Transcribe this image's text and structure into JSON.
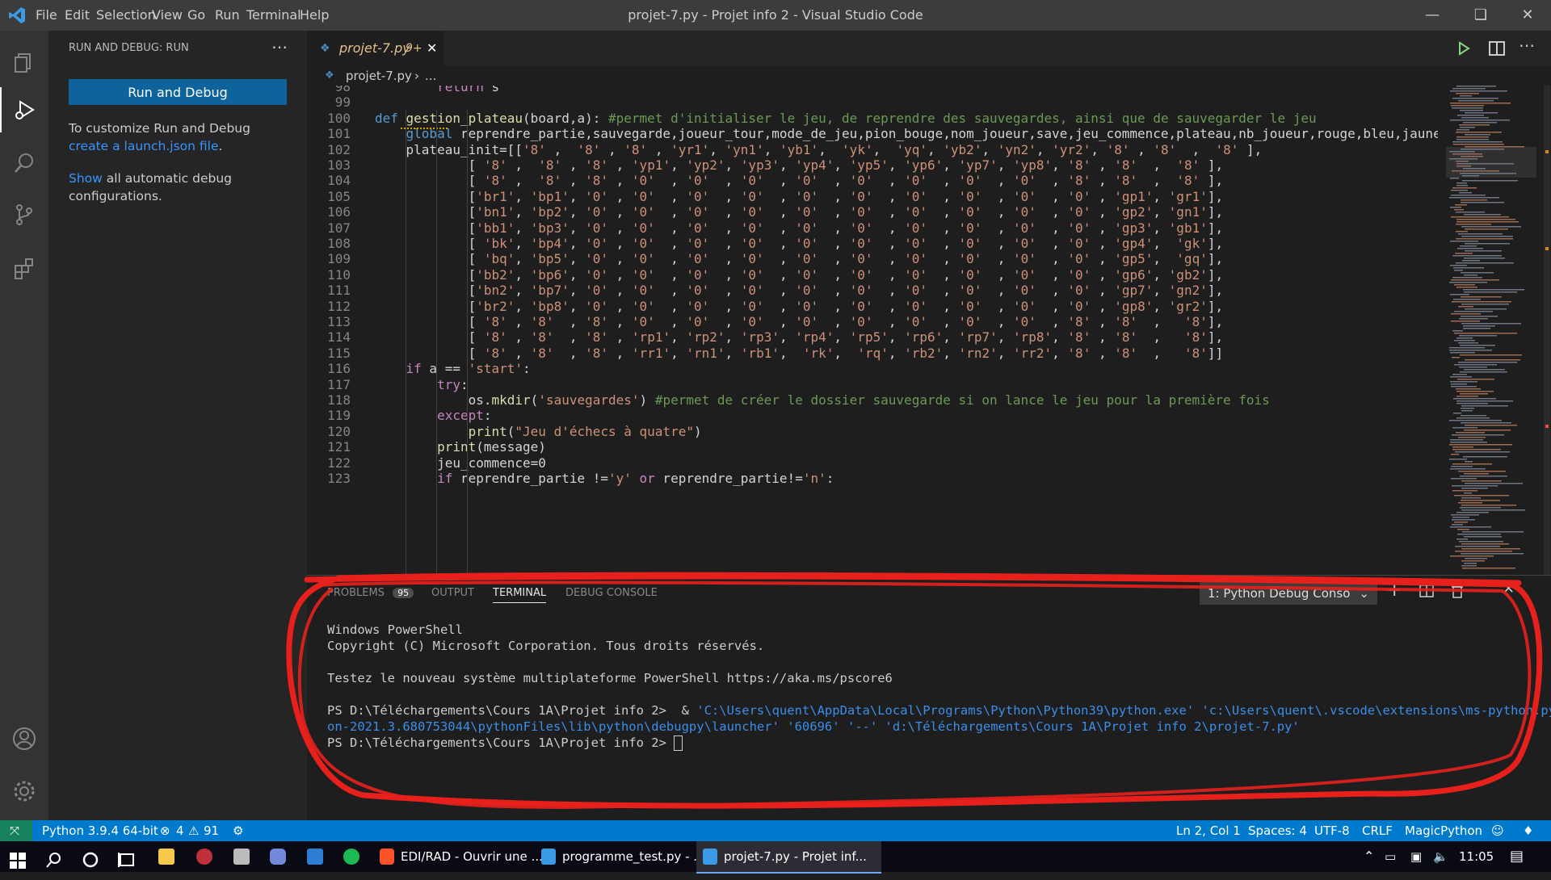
{
  "window": {
    "title": "projet-7.py - Projet info 2 - Visual Studio Code",
    "menu": [
      "File",
      "Edit",
      "Selection",
      "View",
      "Go",
      "Run",
      "Terminal",
      "Help"
    ]
  },
  "sidebar": {
    "header": "RUN AND DEBUG: RUN",
    "run_button": "Run and Debug",
    "text1_prefix": "To customize Run and Debug ",
    "text1_link": "create a launch.json file",
    "text1_suffix": ".",
    "text2_link": "Show",
    "text2_suffix": " all automatic debug configurations."
  },
  "editor": {
    "tab_label": "projet-7.py",
    "tab_badge": "9+",
    "breadcrumb_file": "projet-7.py",
    "breadcrumb_more": "...",
    "lines": [
      {
        "n": "98",
        "t": "        return s"
      },
      {
        "n": "99",
        "t": ""
      },
      {
        "n": "100",
        "t": "def gestion_plateau(board,a): #permet d'initialiser le jeu, de reprendre des sauvegardes, ainsi que de sauvegarder le jeu"
      },
      {
        "n": "101",
        "t": "    global reprendre_partie,sauvegarde,joueur_tour,mode_de_jeu,pion_bouge,nom_joueur,save,jeu_commence,plateau,nb_joueur,rouge,bleu,jaune"
      },
      {
        "n": "102",
        "t": "    plateau_init=[['8' ,  '8' , '8' , 'yr1', 'yn1', 'yb1',  'yk',  'yq', 'yb2', 'yn2', 'yr2', '8' , '8'  ,  '8' ],"
      },
      {
        "n": "103",
        "t": "            [ '8' ,  '8' , '8' , 'yp1', 'yp2', 'yp3', 'yp4', 'yp5', 'yp6', 'yp7', 'yp8', '8' , '8'  ,  '8' ],"
      },
      {
        "n": "104",
        "t": "            [ '8' ,  '8' , '8' , '0'  , '0'  , '0'  , '0'  , '0'  , '0'  , '0'  , '0'  , '8' , '8'  ,  '8' ],"
      },
      {
        "n": "105",
        "t": "            ['br1', 'bp1', '0' , '0'  , '0'  , '0'  , '0'  , '0'  , '0'  , '0'  , '0'  , '0' , 'gp1', 'gr1'],"
      },
      {
        "n": "106",
        "t": "            ['bn1', 'bp2', '0' , '0'  , '0'  , '0'  , '0'  , '0'  , '0'  , '0'  , '0'  , '0' , 'gp2', 'gn1'],"
      },
      {
        "n": "107",
        "t": "            ['bb1', 'bp3', '0' , '0'  , '0'  , '0'  , '0'  , '0'  , '0'  , '0'  , '0'  , '0' , 'gp3', 'gb1'],"
      },
      {
        "n": "108",
        "t": "            [ 'bk', 'bp4', '0' , '0'  , '0'  , '0'  , '0'  , '0'  , '0'  , '0'  , '0'  , '0' , 'gp4',  'gk'],"
      },
      {
        "n": "109",
        "t": "            [ 'bq', 'bp5', '0' , '0'  , '0'  , '0'  , '0'  , '0'  , '0'  , '0'  , '0'  , '0' , 'gp5',  'gq'],"
      },
      {
        "n": "110",
        "t": "            ['bb2', 'bp6', '0' , '0'  , '0'  , '0'  , '0'  , '0'  , '0'  , '0'  , '0'  , '0' , 'gp6', 'gb2'],"
      },
      {
        "n": "111",
        "t": "            ['bn2', 'bp7', '0' , '0'  , '0'  , '0'  , '0'  , '0'  , '0'  , '0'  , '0'  , '0' , 'gp7', 'gn2'],"
      },
      {
        "n": "112",
        "t": "            ['br2', 'bp8', '0' , '0'  , '0'  , '0'  , '0'  , '0'  , '0'  , '0'  , '0'  , '0' , 'gp8', 'gr2'],"
      },
      {
        "n": "113",
        "t": "            [ '8' , '8'  , '8' , '0'  , '0'  , '0'  , '0'  , '0'  , '0'  , '0'  , '0'  , '8' , '8'  ,   '8'],"
      },
      {
        "n": "114",
        "t": "            [ '8' , '8'  , '8' , 'rp1', 'rp2', 'rp3', 'rp4', 'rp5', 'rp6', 'rp7', 'rp8', '8' , '8'  ,   '8'],"
      },
      {
        "n": "115",
        "t": "            [ '8' , '8'  , '8' , 'rr1', 'rn1', 'rb1',  'rk',  'rq', 'rb2', 'rn2', 'rr2', '8' , '8'  ,   '8']]"
      },
      {
        "n": "116",
        "t": "    if a == 'start':"
      },
      {
        "n": "117",
        "t": "        try:"
      },
      {
        "n": "118",
        "t": "            os.mkdir('sauvegardes') #permet de créer le dossier sauvegarde si on lance le jeu pour la première fois"
      },
      {
        "n": "119",
        "t": "        except:"
      },
      {
        "n": "120",
        "t": "            print(\"Jeu d'échecs à quatre\")"
      },
      {
        "n": "121",
        "t": "        print(message)"
      },
      {
        "n": "122",
        "t": "        jeu_commence=0"
      },
      {
        "n": "123",
        "t": "        if reprendre_partie !='y' or reprendre_partie!='n':"
      }
    ]
  },
  "panel": {
    "tabs": [
      "PROBLEMS",
      "OUTPUT",
      "TERMINAL",
      "DEBUG CONSOLE"
    ],
    "problems_count": "95",
    "terminal_select": "1: Python Debug Conso",
    "terminal": {
      "l1": "Windows PowerShell",
      "l2": "Copyright (C) Microsoft Corporation. Tous droits réservés.",
      "l3": "Testez le nouveau système multiplateforme PowerShell https://aka.ms/pscore6",
      "l4_prompt": "PS D:\\Téléchargements\\Cours 1A\\Projet info 2>  & ",
      "l4_cmd": "'C:\\Users\\quent\\AppData\\Local\\Programs\\Python\\Python39\\python.exe' 'c:\\Users\\quent\\.vscode\\extensions\\ms-python.pyth",
      "l5": "on-2021.3.680753044\\pythonFiles\\lib\\python\\debugpy\\launcher' '60696' '--' 'd:\\Téléchargements\\Cours 1A\\Projet info 2\\projet-7.py'",
      "l6": "PS D:\\Téléchargements\\Cours 1A\\Projet info 2> "
    }
  },
  "statusbar": {
    "python": "Python 3.9.4 64-bit",
    "errors": "4",
    "warnings": "91",
    "position": "Ln 2, Col 1",
    "spaces": "Spaces: 4",
    "encoding": "UTF-8",
    "eol": "CRLF",
    "language": "MagicPython"
  },
  "taskbar": {
    "apps": [
      "EDI/RAD - Ouvrir une ...",
      "programme_test.py - ...",
      "projet-7.py - Projet inf..."
    ],
    "time": "11:05"
  },
  "colors": {
    "accent": "#007acc",
    "button": "#0e639c",
    "annotation": "#e8201c"
  }
}
